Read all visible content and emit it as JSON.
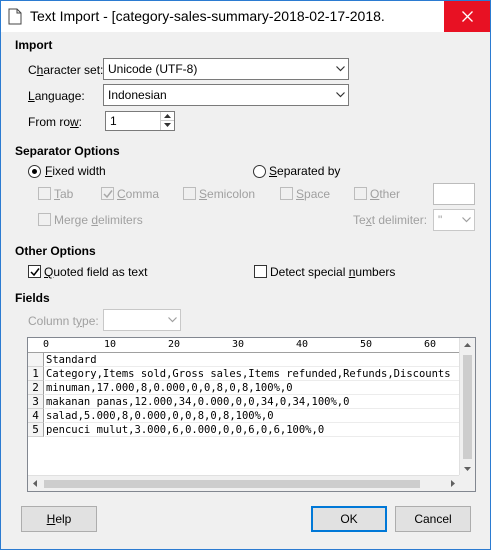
{
  "window": {
    "title": "Text Import - [category-sales-summary-2018-02-17-2018...",
    "close_symbol": "✕"
  },
  "import": {
    "heading": "Import",
    "charset_label_pre": "C",
    "charset_label_u": "h",
    "charset_label_post": "aracter set:",
    "charset_value": "Unicode (UTF-8)",
    "language_label_pre": "",
    "language_label_u": "L",
    "language_label_post": "anguage:",
    "language_value": "Indonesian",
    "fromrow_label_pre": "From ro",
    "fromrow_label_u": "w",
    "fromrow_label_post": ":",
    "fromrow_value": "1"
  },
  "separator": {
    "heading": "Separator Options",
    "fixed_width_u": "F",
    "fixed_width_rest": "ixed width",
    "separated_by_u": "S",
    "separated_by_rest": "eparated by",
    "tab_u": "T",
    "tab_rest": "ab",
    "comma_u": "C",
    "comma_rest": "omma",
    "semicolon_u": "S",
    "semicolon_rest": "emicolon",
    "space_u": "S",
    "space_rest": "pace",
    "other_u": "O",
    "other_rest": "ther",
    "merge_pre": "Merge ",
    "merge_u": "d",
    "merge_post": "elimiters",
    "textdelim_pre": "Te",
    "textdelim_u": "x",
    "textdelim_post": "t delimiter:",
    "textdelim_value": "\""
  },
  "other_options": {
    "heading": "Other Options",
    "quoted_u": "Q",
    "quoted_rest": "uoted field as text",
    "detect_pre": "Detect special ",
    "detect_u": "n",
    "detect_post": "umbers"
  },
  "fields": {
    "heading": "Fields",
    "column_type_pre": "Column t",
    "column_type_u": "y",
    "column_type_post": "pe:",
    "ruler": [
      "0",
      "10",
      "20",
      "30",
      "40",
      "50",
      "60"
    ],
    "row_numbers": [
      "1",
      "2",
      "3",
      "4",
      "5"
    ],
    "header_row": "Standard",
    "rows": [
      "Category,Items sold,Gross sales,Items refunded,Refunds,Discounts",
      "minuman,17.000,8,0.000,0,0,8,0,8,100%,0",
      "makanan panas,12.000,34,0.000,0,0,34,0,34,100%,0",
      "salad,5.000,8,0.000,0,0,8,0,8,100%,0",
      "pencuci mulut,3.000,6,0.000,0,0,6,0,6,100%,0"
    ]
  },
  "buttons": {
    "help_u": "H",
    "help_rest": "elp",
    "ok": "OK",
    "cancel": "Cancel"
  },
  "colors": {
    "close_bg": "#e81123",
    "default_button_border": "#0078d7"
  }
}
